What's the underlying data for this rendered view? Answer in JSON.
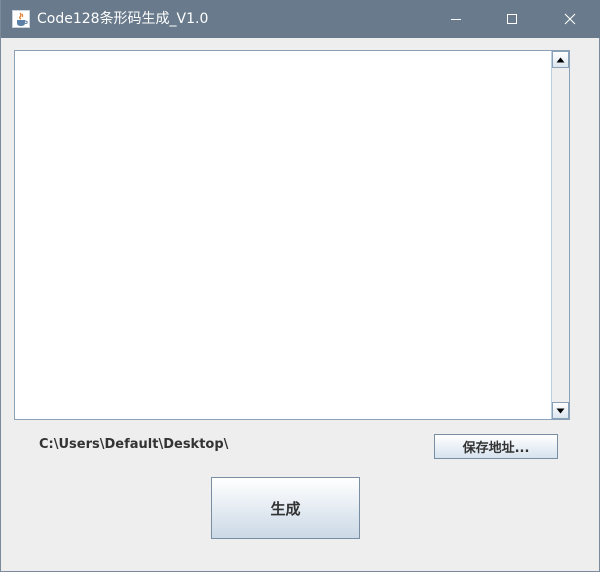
{
  "window": {
    "title": "Code128条形码生成_V1.0",
    "icon": "java-cup-icon",
    "controls": [
      "minimize-icon",
      "maximize-icon",
      "close-icon"
    ]
  },
  "text_area": {
    "value": ""
  },
  "save_path": {
    "label": "C:\\Users\\Default\\Desktop\\",
    "button_label": "保存地址..."
  },
  "generate": {
    "button_label": "生成"
  },
  "colors": {
    "titlebar": "#687a8b",
    "background": "#eeeeee",
    "button_gradient_bottom": "#cbd9e6",
    "border": "#7a8ea3"
  }
}
